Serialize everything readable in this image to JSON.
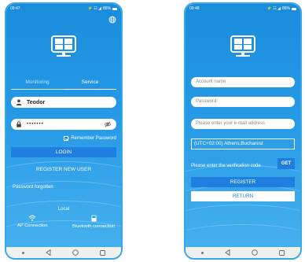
{
  "login_screen": {
    "status": {
      "time": "09:47",
      "signal": "⚡ ☷ ◢",
      "battery": "86%"
    },
    "tabs": {
      "monitoring": "Monitoring",
      "service": "Service"
    },
    "username": "Teodor",
    "password_mask": "•••••••",
    "remember_label": "Remember Password",
    "login_label": "LOGIN",
    "register_label": "REGISTER NEW USER",
    "forgot_label": "Password forgotten",
    "local_label": "Local",
    "ap_label": "AP Connection",
    "bt_label": "Bluetooth connection"
  },
  "register_screen": {
    "status": {
      "time": "09:48",
      "signal": "⚡ ☷ ◢",
      "battery": "86%"
    },
    "account_placeholder": "Account name",
    "password_placeholder": "Password",
    "email_placeholder": "Please enter your e-mail address",
    "timezone_value": "(UTC+02:00) Athens,Bucharest",
    "verification_placeholder": "Please enter the verification code",
    "get_label": "GET",
    "register_label": "REGISTER",
    "return_label": "RETURN"
  },
  "colors": {
    "accent": "#1f7fe0",
    "frame": "#35a9e6",
    "screen_top": "#1a8cdc"
  }
}
